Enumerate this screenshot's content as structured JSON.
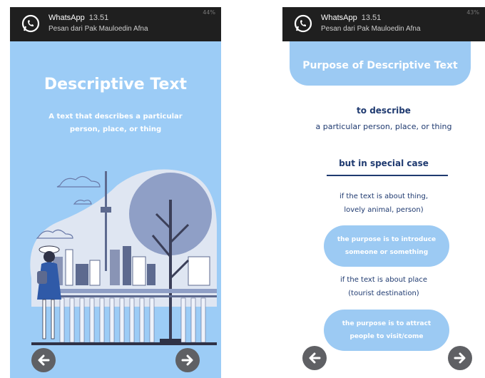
{
  "notification": {
    "app": "WhatsApp",
    "time": "13.51",
    "message": "Pesan dari Pak Mauloedin Afna",
    "status_left": "13.51",
    "status_right_left_phone": "44%",
    "status_right_right_phone": "43%"
  },
  "left_screen": {
    "title": "Descriptive Text",
    "subtitle_line1": "A text that describes a particular",
    "subtitle_line2": "person, place, or thing",
    "prev_icon": "arrow-left-icon",
    "next_icon": "arrow-right-icon"
  },
  "right_screen": {
    "header_title": "Purpose of Descriptive Text",
    "line1": "to describe",
    "line2": "a particular person, place, or thing",
    "special": "but in special case",
    "case1_line1": "if the text is about thing,",
    "case1_line2": "lovely animal, person)",
    "purpose1_line1": "the purpose is to introduce",
    "purpose1_line2": "someone or something",
    "case2_line1": "if the text is about place",
    "case2_line2": "(tourist destination)",
    "purpose2_line1": "the purpose is to attract",
    "purpose2_line2": "people to visit/come"
  },
  "colors": {
    "sky": "#9cccf6",
    "dark_blue": "#1f3a70",
    "pill": "#9ccaf3",
    "nav_button": "#5f6064"
  }
}
